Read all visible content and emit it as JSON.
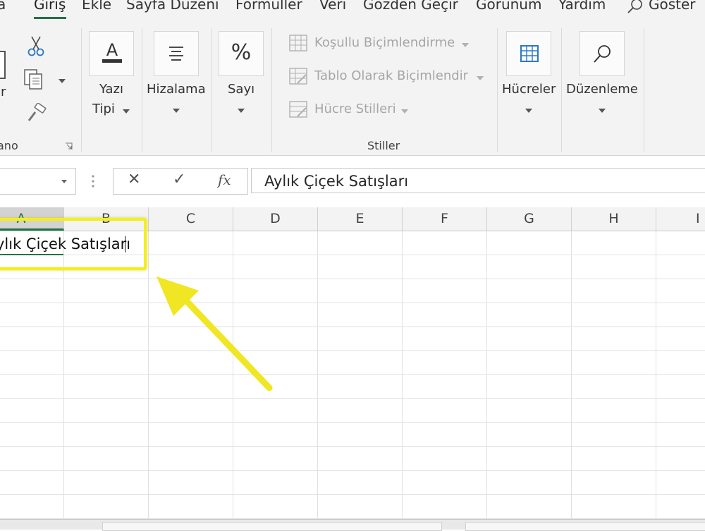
{
  "menu": {
    "tabs": [
      "a",
      "Giriş",
      "Ekle",
      "Sayfa Düzeni",
      "Formüller",
      "Veri",
      "Gözden Geçir",
      "Görünüm",
      "Yardım"
    ],
    "tell_me": "Göster"
  },
  "ribbon": {
    "clipboard": {
      "paste_partial": "ır",
      "group_label": "ano"
    },
    "font": {
      "label_line1": "Yazı",
      "label_line2": "Tipi"
    },
    "alignment": {
      "label": "Hizalama"
    },
    "number": {
      "label": "Sayı",
      "icon_glyph": "%"
    },
    "styles": {
      "conditional": "Koşullu Biçimlendirme",
      "table": "Tablo Olarak Biçimlendir",
      "cell_styles": "Hücre Stilleri",
      "group_label": "Stiller"
    },
    "cells": {
      "label": "Hücreler"
    },
    "editing": {
      "label": "Düzenleme"
    }
  },
  "formula_bar": {
    "cancel_glyph": "✕",
    "enter_glyph": "✓",
    "fx_glyph": "fx",
    "value": "Aylık Çiçek Satışları"
  },
  "grid": {
    "columns": [
      "A",
      "B",
      "C",
      "D",
      "E",
      "F",
      "G",
      "H",
      "I"
    ],
    "selected_column": "A",
    "active_cell_text": "ylık Çiçek Satışları"
  },
  "colors": {
    "accent": "#217346",
    "highlight": "#f5ee1d"
  }
}
